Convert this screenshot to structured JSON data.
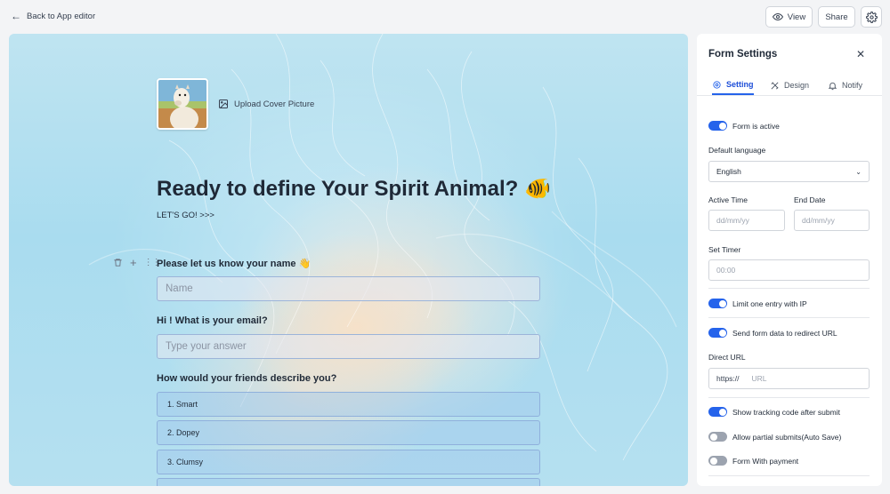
{
  "topbar": {
    "back_label": "Back to App editor",
    "view_label": "View",
    "share_label": "Share"
  },
  "canvas": {
    "upload_label": "Upload Cover Picture",
    "title": "Ready to define Your Spirit Animal? 🐠",
    "subtitle": "LET'S GO! >>>",
    "questions": [
      {
        "label": "Please let us know your name 👋",
        "placeholder": "Name"
      },
      {
        "label": "Hi ! What is your email?",
        "placeholder": "Type your answer"
      },
      {
        "label": "How would your friends describe you?",
        "options": [
          "1. Smart",
          "2. Dopey",
          "3. Clumsy"
        ]
      }
    ]
  },
  "settings": {
    "title": "Form Settings",
    "tabs": [
      "Setting",
      "Design",
      "Notify"
    ],
    "active_tab": "Setting",
    "form_active": {
      "label": "Form is active",
      "on": true
    },
    "default_language": {
      "label": "Default language",
      "value": "English"
    },
    "active_time": {
      "label": "Active Time",
      "placeholder": "dd/mm/yy"
    },
    "end_date": {
      "label": "End Date",
      "placeholder": "dd/mm/yy"
    },
    "set_timer": {
      "label": "Set Timer",
      "placeholder": "00:00"
    },
    "limit_entry": {
      "label": "Limit one entry with IP",
      "on": true
    },
    "send_redirect": {
      "label": "Send form data to redirect URL",
      "on": true
    },
    "direct_url": {
      "label": "Direct URL",
      "prefix": "https://",
      "placeholder": "URL"
    },
    "tracking_code": {
      "label": "Show tracking code after submit",
      "on": true
    },
    "partial_submits": {
      "label": "Allow partial submits(Auto Save)",
      "on": false
    },
    "payment": {
      "label": "Form With payment",
      "on": false
    }
  },
  "colors": {
    "accent": "#2563eb",
    "toggle_off": "#9ca3af",
    "canvas_sky": "#a9dcef"
  }
}
